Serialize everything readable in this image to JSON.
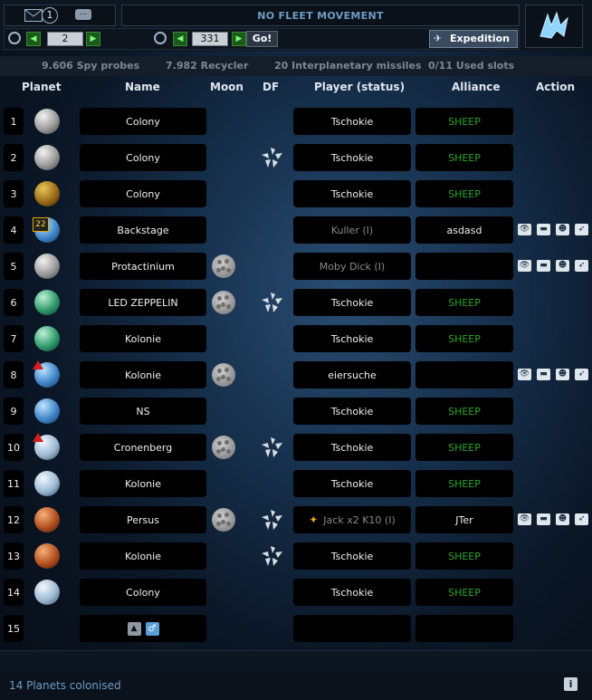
{
  "header": {
    "unread_count": "1",
    "fleet_status": "NO FLEET MOVEMENT",
    "galaxy_value": "2",
    "system_value": "331",
    "go_label": "Go!",
    "expedition_label": "Expedition"
  },
  "summary": {
    "spy_probes": "9.606 Spy probes",
    "recyclers": "7.982 Recycler",
    "missiles": "20 Interplanetary missiles",
    "slots": "0/11 Used slots"
  },
  "columns": {
    "planet": "Planet",
    "name": "Name",
    "moon": "Moon",
    "df": "DF",
    "player": "Player (status)",
    "alliance": "Alliance",
    "action": "Action"
  },
  "colors": {
    "own_alliance": "#2aa52a",
    "inactive_player": "#8a8a8a",
    "accent": "#6d9cc7"
  },
  "rows": [
    {
      "pos": "1",
      "name": "Colony",
      "moon": false,
      "df": false,
      "player": "Tschokie",
      "alliance": "SHEEP",
      "own": true,
      "actions": false
    },
    {
      "pos": "2",
      "name": "Colony",
      "moon": false,
      "df": true,
      "player": "Tschokie",
      "alliance": "SHEEP",
      "own": true,
      "actions": false
    },
    {
      "pos": "3",
      "name": "Colony",
      "moon": false,
      "df": false,
      "player": "Tschokie",
      "alliance": "SHEEP",
      "own": true,
      "actions": false
    },
    {
      "pos": "4",
      "name": "Backstage",
      "moon": false,
      "df": false,
      "player": "Kuller (I)",
      "alliance": "asdasd",
      "own": false,
      "inactive": true,
      "actions": true,
      "badge": "22"
    },
    {
      "pos": "5",
      "name": "Protactinium",
      "moon": true,
      "df": false,
      "player": "Moby Dick (I)",
      "alliance": "",
      "own": false,
      "inactive": true,
      "actions": true
    },
    {
      "pos": "6",
      "name": "LED ZEPPELIN",
      "moon": true,
      "df": true,
      "player": "Tschokie",
      "alliance": "SHEEP",
      "own": true,
      "actions": false
    },
    {
      "pos": "7",
      "name": "Kolonie",
      "moon": false,
      "df": false,
      "player": "Tschokie",
      "alliance": "SHEEP",
      "own": true,
      "actions": false
    },
    {
      "pos": "8",
      "name": "Kolonie",
      "moon": true,
      "df": false,
      "player": "eiersuche",
      "alliance": "",
      "own": false,
      "actions": true,
      "warn": true
    },
    {
      "pos": "9",
      "name": "NS",
      "moon": false,
      "df": false,
      "player": "Tschokie",
      "alliance": "SHEEP",
      "own": true,
      "actions": false
    },
    {
      "pos": "10",
      "name": "Cronenberg",
      "moon": true,
      "df": true,
      "player": "Tschokie",
      "alliance": "SHEEP",
      "own": true,
      "actions": false,
      "warn": true
    },
    {
      "pos": "11",
      "name": "Kolonie",
      "moon": false,
      "df": false,
      "player": "Tschokie",
      "alliance": "SHEEP",
      "own": true,
      "actions": false
    },
    {
      "pos": "12",
      "name": "Persus",
      "moon": true,
      "df": true,
      "player": "Jack x2 K10 (I)",
      "alliance": "JTer",
      "own": false,
      "inactive": true,
      "actions": true,
      "outlaw": true
    },
    {
      "pos": "13",
      "name": "Kolonie",
      "moon": false,
      "df": true,
      "player": "Tschokie",
      "alliance": "SHEEP",
      "own": true,
      "actions": false
    },
    {
      "pos": "14",
      "name": "Colony",
      "moon": false,
      "df": false,
      "player": "Tschokie",
      "alliance": "SHEEP",
      "own": true,
      "actions": false
    },
    {
      "pos": "15",
      "name": "",
      "moon": false,
      "df": false,
      "player": "",
      "alliance": "",
      "own": false,
      "actions": false,
      "empty": true
    }
  ],
  "planet_icons": [
    "gray-planet-icon",
    "gray-planet-icon",
    "amber-planet-icon",
    "blue-planet-icon",
    "gray-planet-icon",
    "green-planet-icon",
    "green-planet-icon",
    "blue-planet-icon",
    "blue-planet-icon",
    "ice-planet-icon",
    "ice-planet-icon",
    "desert-planet-icon",
    "desert-planet-icon",
    "ice-planet-icon",
    ""
  ],
  "footer": {
    "colonised": "14 Planets colonised",
    "info_icon": "i"
  }
}
